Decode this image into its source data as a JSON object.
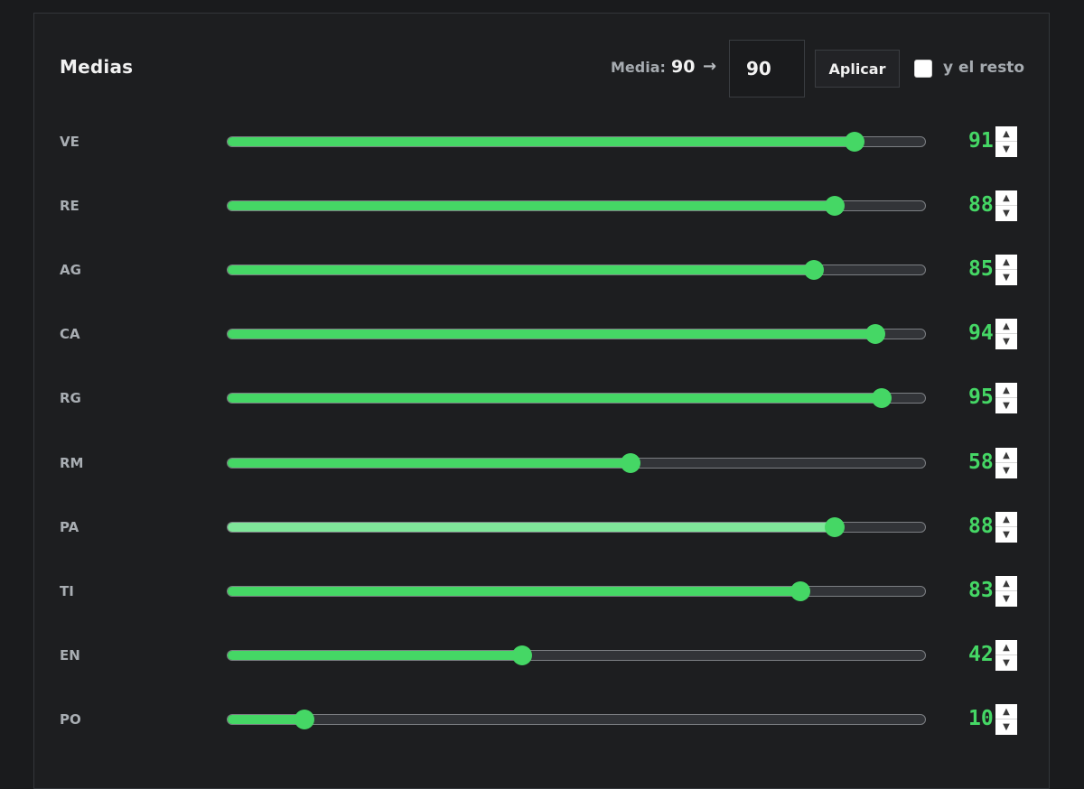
{
  "header": {
    "title": "Medias",
    "media_label": "Media:",
    "media_value": "90",
    "arrow_icon": "arrow-right-icon",
    "input_value": "90",
    "apply_label": "Aplicar",
    "rest_label": "y el resto",
    "rest_checked": false
  },
  "colors": {
    "accent": "#45d765",
    "accent_light": "#7fe79a",
    "background": "#1a1b1d"
  },
  "stats": [
    {
      "label": "VE",
      "value": 91,
      "display": "91",
      "highlight": false
    },
    {
      "label": "RE",
      "value": 88,
      "display": "88",
      "highlight": false
    },
    {
      "label": "AG",
      "value": 85,
      "display": "85",
      "highlight": false
    },
    {
      "label": "CA",
      "value": 94,
      "display": "94",
      "highlight": false
    },
    {
      "label": "RG",
      "value": 95,
      "display": "95",
      "highlight": false
    },
    {
      "label": "RM",
      "value": 58,
      "display": "58",
      "highlight": false
    },
    {
      "label": "PA",
      "value": 88,
      "display": "88",
      "highlight": true
    },
    {
      "label": "TI",
      "value": 83,
      "display": "83",
      "highlight": false
    },
    {
      "label": "EN",
      "value": 42,
      "display": "42",
      "highlight": false
    },
    {
      "label": "PO",
      "value": 10,
      "display": "10",
      "highlight": false
    }
  ],
  "slider_range": [
    0,
    100
  ]
}
